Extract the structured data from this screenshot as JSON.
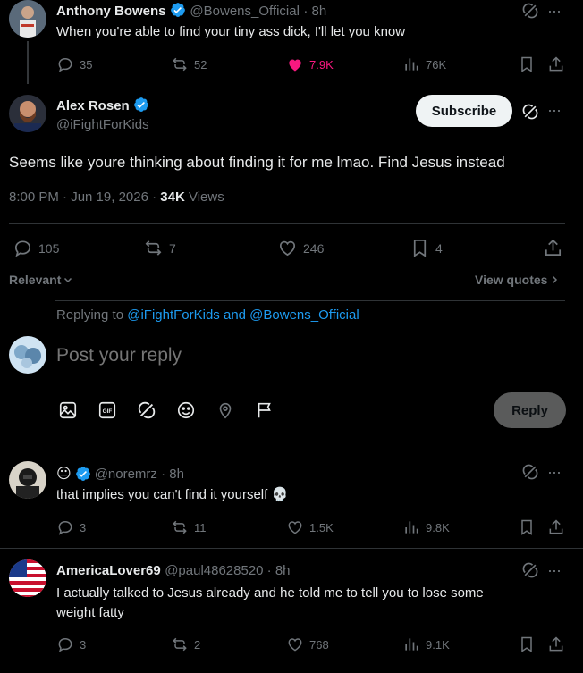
{
  "parent_tweet": {
    "name": "Anthony Bowens",
    "handle": "@Bowens_Official",
    "time": "· 8h",
    "text": "When you're able to find your tiny ass dick, I'll let you know",
    "replies": "35",
    "retweets": "52",
    "likes": "7.9K",
    "views": "76K"
  },
  "main_tweet": {
    "name": "Alex Rosen",
    "handle": "@iFightForKids",
    "subscribe_label": "Subscribe",
    "text": "Seems like youre thinking about finding it for me lmao. Find Jesus instead",
    "timestamp": "8:00 PM · Jun 19, 2026 · ",
    "views_count": "34K",
    "views_label": " Views",
    "replies": "105",
    "retweets": "7",
    "likes": "246",
    "bookmarks": "4"
  },
  "sort": {
    "relevant_label": "Relevant",
    "view_quotes_label": "View quotes"
  },
  "composer": {
    "replying_prefix": "Replying to ",
    "replying_users": "@iFightForKids and @Bowens_Official",
    "placeholder": "Post your reply",
    "reply_label": "Reply"
  },
  "replies": [
    {
      "name_emoji": "😐",
      "handle": "@noremrz · 8h",
      "text": "that implies you can't find it yourself 💀",
      "replies": "3",
      "retweets": "11",
      "likes": "1.5K",
      "views": "9.8K"
    },
    {
      "name": "AmericaLover69",
      "handle": "@paul48628520 · 8h",
      "text_line1": "I actually talked to Jesus already and he told me to tell you to lose some",
      "text_line2": "weight fatty",
      "replies": "3",
      "retweets": "2",
      "likes": "768",
      "views": "9.1K"
    }
  ],
  "colors": {
    "background": "#000000",
    "text": "#e7e9ea",
    "muted": "#71767b",
    "accent": "#1d9bf0",
    "like_active": "#f91880",
    "divider": "#2f3336"
  }
}
